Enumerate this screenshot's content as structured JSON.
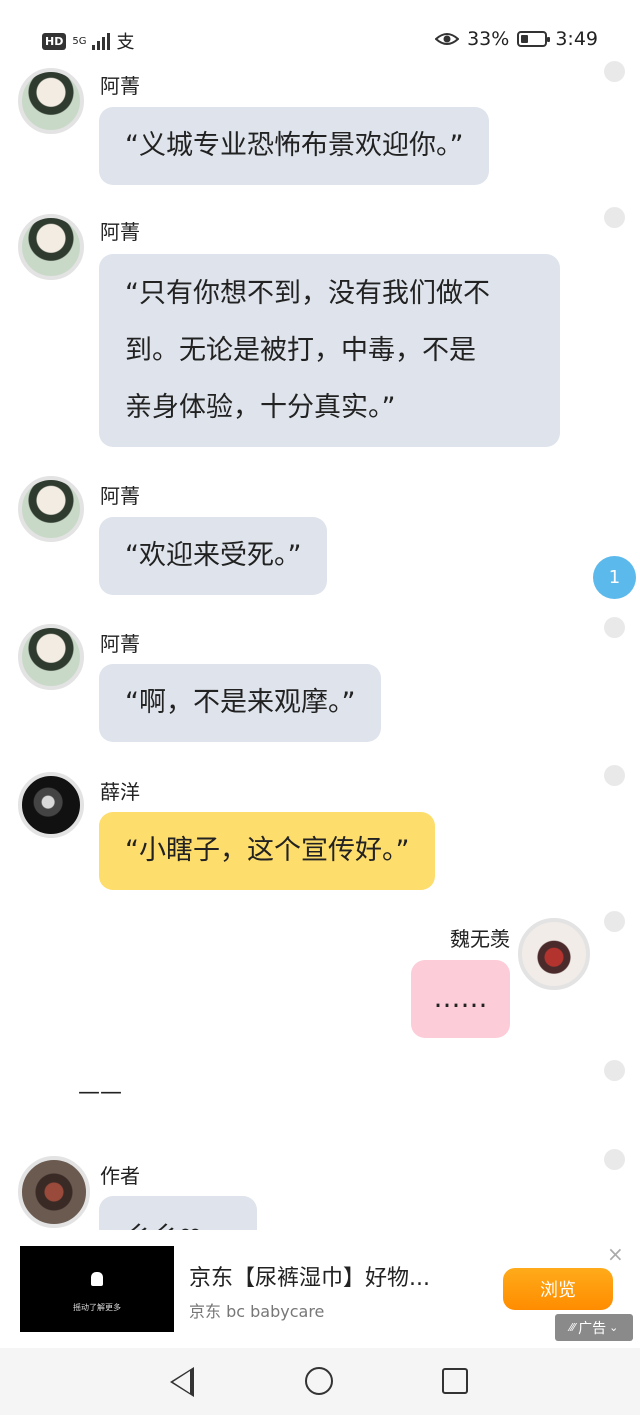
{
  "status_bar": {
    "hd": "HD",
    "network": "5G",
    "battery_percent": "33%",
    "battery_level": 0.33,
    "time": "3:49"
  },
  "chat": {
    "messages": [
      {
        "sender": "阿菁",
        "text": "“义城专业恐怖布景欢迎你。”",
        "side": "left",
        "bubble": "gray",
        "avatar": "girl-green"
      },
      {
        "sender": "阿菁",
        "lines": [
          "“只有你想不到，没有我们做不",
          "到。无论是被打，中毒，不是",
          "亲身体验，十分真实。”"
        ],
        "side": "left",
        "bubble": "gray",
        "avatar": "girl-green"
      },
      {
        "sender": "阿菁",
        "text": "“欢迎来受死。”",
        "side": "left",
        "bubble": "gray",
        "avatar": "girl-green"
      },
      {
        "sender": "阿菁",
        "text": "“啊，不是来观摩。”",
        "side": "left",
        "bubble": "gray",
        "avatar": "girl-green"
      },
      {
        "sender": "薛洋",
        "text": "“小瞎子，这个宣传好。”",
        "side": "left",
        "bubble": "yellow",
        "avatar": "boy-dark"
      },
      {
        "sender": "魏无羡",
        "text": "……",
        "side": "right",
        "bubble": "pink",
        "avatar": "boy-red"
      }
    ],
    "divider": "——",
    "last_sender": "作者",
    "last_preview": "乡乡❤",
    "unread_count": "1"
  },
  "ad": {
    "thumb_caption": "摇动了解更多",
    "title": "京东【尿裤湿巾】好物...",
    "subtitle": "京东 bc babycare",
    "button": "浏览",
    "badge": "广告",
    "close": "×"
  },
  "colors": {
    "bubble_gray": "#dfe4ec",
    "bubble_yellow": "#fddd6c",
    "bubble_pink": "#fccdd8",
    "unread": "#5cb9ec",
    "ad_button": "#ff9a0a"
  }
}
